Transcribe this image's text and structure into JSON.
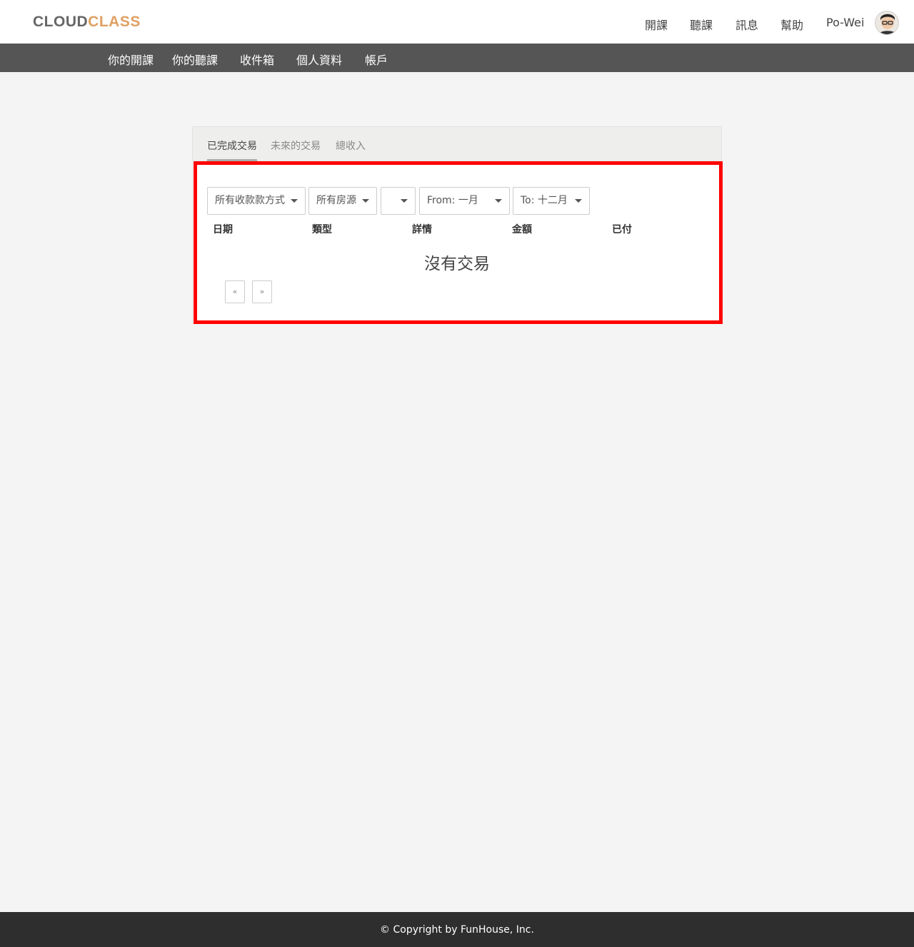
{
  "header": {
    "logo_part1": "CLOUD",
    "logo_part2": "CLASS",
    "nav": {
      "open_course": "開課",
      "listen_course": "聽課",
      "messages": "訊息",
      "help": "幫助",
      "user_name": "Po-Wei"
    }
  },
  "subnav": {
    "items": [
      "你的開課",
      "你的聽課",
      "收件箱",
      "個人資料",
      "帳戶"
    ]
  },
  "tabs": {
    "items": [
      "已完成交易",
      "未來的交易",
      "總收入"
    ],
    "active": "已完成交易"
  },
  "filters": {
    "payment_method": "所有收款款方式",
    "listing": "所有房源",
    "year": "",
    "from": "From: 一月",
    "to": "To: 十二月"
  },
  "table": {
    "columns": [
      "日期",
      "類型",
      "詳情",
      "金額",
      "已付"
    ]
  },
  "empty_message": "沒有交易",
  "pagination": {
    "prev": "«",
    "next": "»"
  },
  "footer": {
    "copyright": "© Copyright by FunHouse, Inc."
  },
  "colors": {
    "logo_accent": "#e0a062",
    "subnav_bg": "#555555",
    "footer_bg": "#2e2e2e",
    "highlight": "#ff0000"
  }
}
